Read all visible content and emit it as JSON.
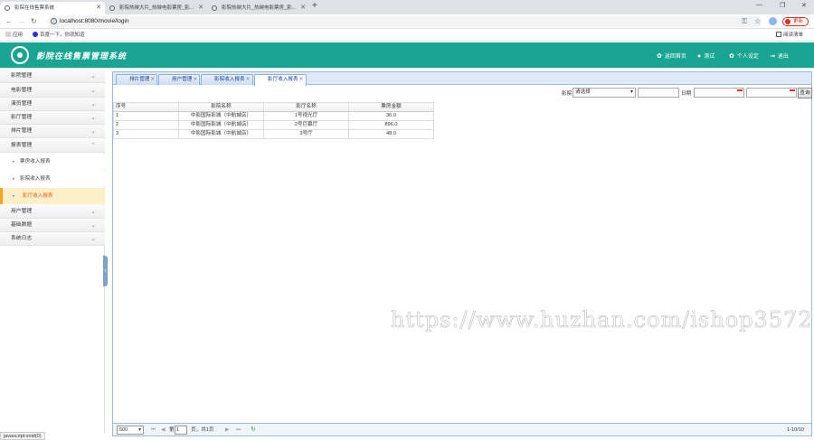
{
  "browser": {
    "tabs": [
      {
        "label": "影院在线售票系统"
      },
      {
        "label": "影院热映大片_热映电影票房_影..."
      },
      {
        "label": "影院热映大片_热映电影票房_影..."
      }
    ],
    "url": "localhost:8080/movie/login",
    "update_label": "更新",
    "bookmarks": [
      {
        "label": "应用"
      },
      {
        "label": "百度一下，你就知道"
      },
      {
        "label": "阅读清单"
      }
    ]
  },
  "app": {
    "title": "影院在线售票管理系统",
    "nav": [
      {
        "label": "返回首页",
        "icon": "gear-icon"
      },
      {
        "label": "测试",
        "icon": "user-icon"
      },
      {
        "label": "个人设定",
        "icon": "gear-icon"
      },
      {
        "label": "退出",
        "icon": "exit-icon"
      }
    ]
  },
  "sidebar": {
    "groups": [
      {
        "label": "影院管理"
      },
      {
        "label": "电影管理"
      },
      {
        "label": "演员管理"
      },
      {
        "label": "影厅管理"
      },
      {
        "label": "排片管理"
      },
      {
        "label": "报表管理"
      }
    ],
    "report_items": [
      {
        "label": "票房收入报表"
      },
      {
        "label": "影院收入报表"
      },
      {
        "label": "影厅收入报表"
      }
    ],
    "bottom_groups": [
      {
        "label": "用户管理"
      },
      {
        "label": "基础数据"
      },
      {
        "label": "系统日志"
      }
    ]
  },
  "page_tabs": [
    {
      "label": "排片管理"
    },
    {
      "label": "用户管理"
    },
    {
      "label": "影院收入报表"
    },
    {
      "label": "影厅收入报表"
    }
  ],
  "toolbar": {
    "cinema_label": "影院",
    "cinema_select": "请选择",
    "date_label": "日期",
    "query_label": "查询"
  },
  "grid": {
    "columns": [
      "序号",
      "影院名称",
      "影厅名称",
      "票房金额"
    ],
    "rows": [
      [
        "1",
        "中影国际影城（中航城店）",
        "1号视光厅",
        "36.0"
      ],
      [
        "2",
        "中影国际影城（中航城店）",
        "2号巨幕厅",
        "896.0"
      ],
      [
        "3",
        "中影国际影城（中航城店）",
        "3号厅",
        "48.0"
      ]
    ]
  },
  "pager": {
    "page_size": "500",
    "page_prefix": "第",
    "page_value": "1",
    "page_suffix": "页，共1页",
    "summary": "1-10/10"
  },
  "watermark": "https://www.huzhan.com/ishop3572",
  "status_text": "javascript:void(0)"
}
